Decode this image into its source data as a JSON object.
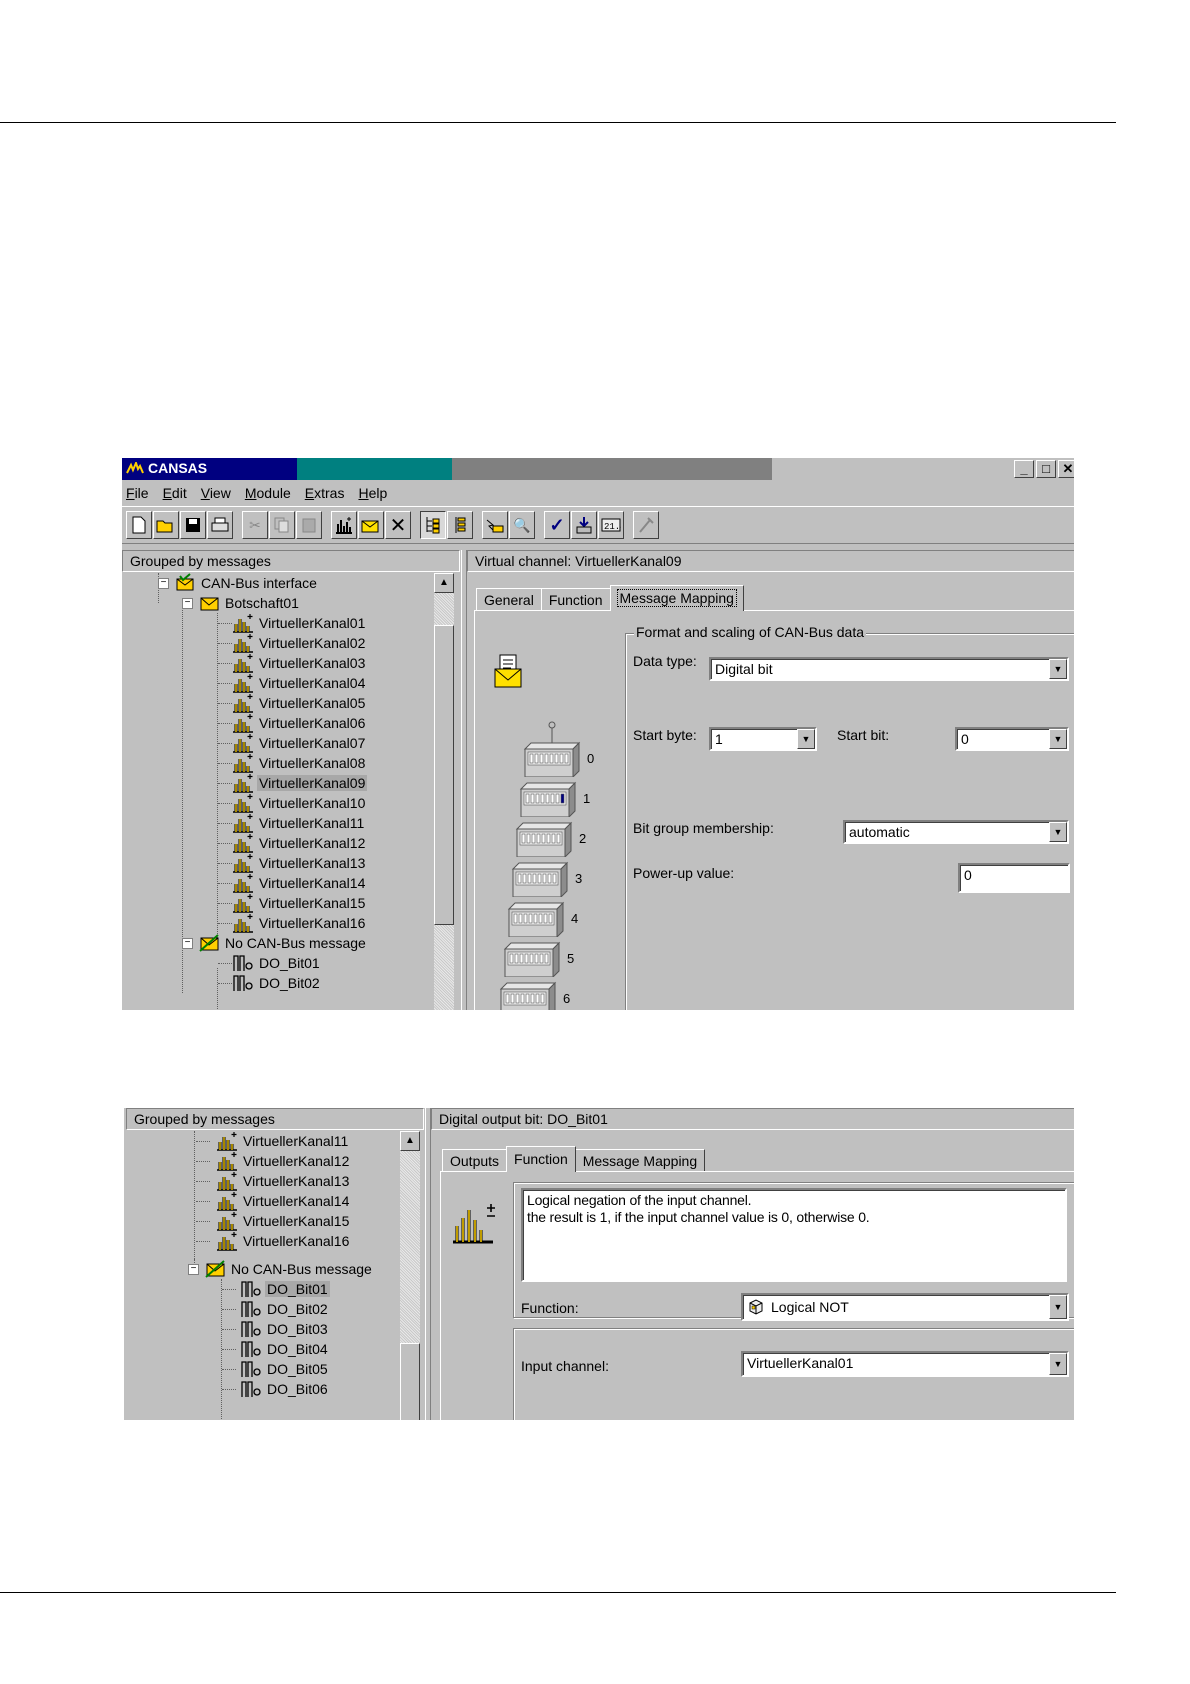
{
  "app": {
    "title": "CANSAS",
    "window_buttons": [
      "_",
      "□",
      "✕"
    ],
    "menu": [
      "File",
      "Edit",
      "View",
      "Module",
      "Extras",
      "Help"
    ],
    "toolbar_icons": [
      "new-file-icon",
      "open-folder-icon",
      "save-icon",
      "print-icon",
      "cut-icon",
      "copy-icon",
      "paste-icon",
      "new-channel-icon",
      "new-message-icon",
      "delete-icon",
      "tree-messages-icon",
      "tree-list-icon",
      "connect-icon",
      "find-icon",
      "check-icon",
      "download-icon",
      "numeric-display-icon",
      "tool-icon"
    ]
  },
  "shot1": {
    "tree_header": "Grouped by messages",
    "tree": {
      "interface": "CAN-Bus interface",
      "message": "Botschaft01",
      "channels": [
        "VirtuellerKanal01",
        "VirtuellerKanal02",
        "VirtuellerKanal03",
        "VirtuellerKanal04",
        "VirtuellerKanal05",
        "VirtuellerKanal06",
        "VirtuellerKanal07",
        "VirtuellerKanal08",
        "VirtuellerKanal09",
        "VirtuellerKanal10",
        "VirtuellerKanal11",
        "VirtuellerKanal12",
        "VirtuellerKanal13",
        "VirtuellerKanal14",
        "VirtuellerKanal15",
        "VirtuellerKanal16"
      ],
      "selected": "VirtuellerKanal09",
      "no_message": "No CAN-Bus message",
      "outputs": [
        "DO_Bit01",
        "DO_Bit02"
      ]
    },
    "detail_header": "Virtual channel: VirtuellerKanal09",
    "tabs": [
      "General",
      "Function",
      "Message Mapping"
    ],
    "active_tab": "Message Mapping",
    "group_title": "Format and scaling of CAN-Bus data",
    "data_type_label": "Data type:",
    "data_type_value": "Digital bit",
    "start_byte_label": "Start byte:",
    "start_byte_value": "1",
    "start_bit_label": "Start bit:",
    "start_bit_value": "0",
    "bit_group_label": "Bit group membership:",
    "bit_group_value": "automatic",
    "powerup_label": "Power-up value:",
    "powerup_value": "0",
    "byte_numbers": [
      "0",
      "1",
      "2",
      "3",
      "4",
      "5",
      "6"
    ]
  },
  "shot2": {
    "tree_header": "Grouped by messages",
    "tree": {
      "channels": [
        "VirtuellerKanal11",
        "VirtuellerKanal12",
        "VirtuellerKanal13",
        "VirtuellerKanal14",
        "VirtuellerKanal15",
        "VirtuellerKanal16"
      ],
      "no_message": "No CAN-Bus message",
      "outputs": [
        "DO_Bit01",
        "DO_Bit02",
        "DO_Bit03",
        "DO_Bit04",
        "DO_Bit05",
        "DO_Bit06"
      ],
      "selected": "DO_Bit01"
    },
    "detail_header": "Digital output bit: DO_Bit01",
    "tabs": [
      "Outputs",
      "Function",
      "Message Mapping"
    ],
    "active_tab": "Function",
    "description_line1": "Logical negation of the input channel.",
    "description_line2": "the result is 1, if the input channel value is 0, otherwise 0.",
    "function_label": "Function:",
    "function_value": "Logical NOT",
    "input_label": "Input channel:",
    "input_value": "VirtuellerKanal01"
  }
}
